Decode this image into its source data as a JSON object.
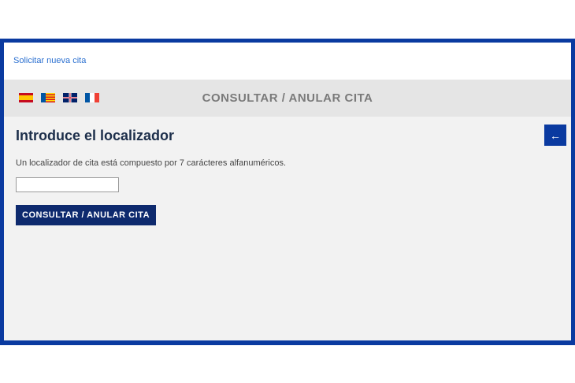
{
  "topbar": {
    "new_appointment_link": "Solicitar nueva cita"
  },
  "header": {
    "title": "CONSULTAR / ANULAR CITA",
    "flags": [
      "spain-flag-icon",
      "valencia-flag-icon",
      "uk-flag-icon",
      "france-flag-icon"
    ]
  },
  "main": {
    "heading": "Introduce el localizador",
    "description": "Un localizador de cita está compuesto por 7 carácteres alfanuméricos.",
    "input_value": "",
    "submit_label": "CONSULTAR / ANULAR CITA",
    "back_icon": "arrow-left-icon"
  },
  "colors": {
    "frame": "#0a3aa0",
    "button": "#0e2a6e",
    "link": "#2a6fd0"
  }
}
